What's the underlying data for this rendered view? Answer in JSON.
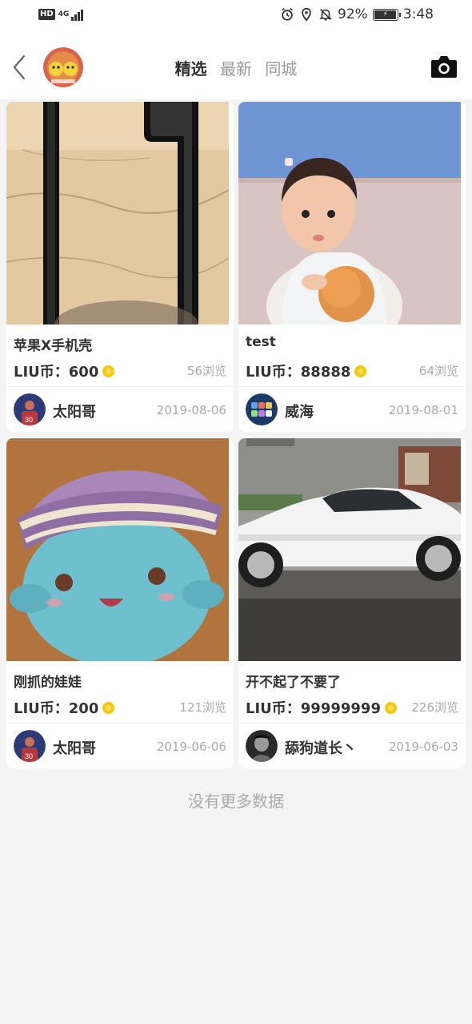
{
  "status_bar": {
    "hd": "HD",
    "network": "4G",
    "battery": "92%",
    "time": "3:48"
  },
  "nav": {
    "tabs": [
      {
        "label": "精选",
        "active": true
      },
      {
        "label": "最新",
        "active": false
      },
      {
        "label": "同城",
        "active": false
      }
    ]
  },
  "posts": [
    {
      "title": "苹果X手机壳",
      "price": "LIU币：600",
      "views": "56浏览",
      "user": "太阳哥",
      "date": "2019-08-06"
    },
    {
      "title": "test",
      "price": "LIU币：88888",
      "views": "64浏览",
      "user": "威海",
      "date": "2019-08-01"
    },
    {
      "title": "刚抓的娃娃",
      "price": "LIU币：200",
      "views": "121浏览",
      "user": "太阳哥",
      "date": "2019-06-06"
    },
    {
      "title": "开不起了不要了",
      "price": "LIU币：99999999",
      "views": "226浏览",
      "user": "舔狗道长丶",
      "date": "2019-06-03"
    }
  ],
  "footer": {
    "no_more": "没有更多数据"
  },
  "colors": {
    "background": "#f4f4f4",
    "coin": "#f6c70c",
    "muted_text": "#aaaaaa"
  }
}
